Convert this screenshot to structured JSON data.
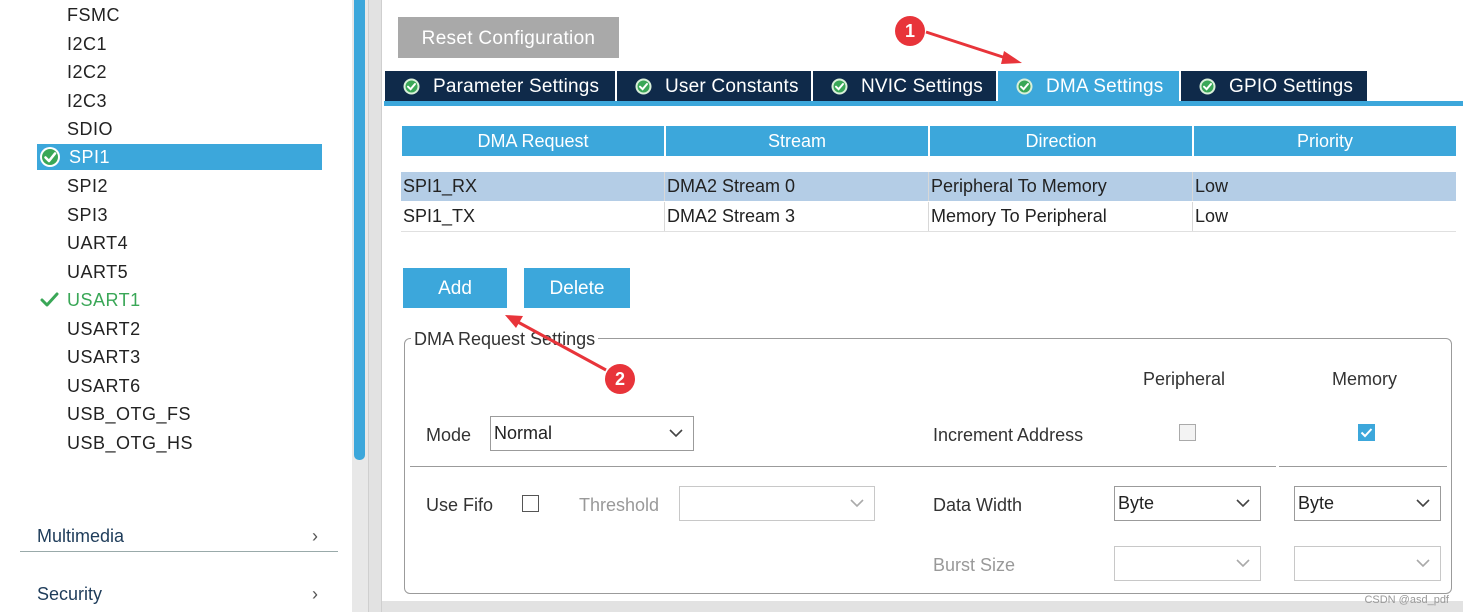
{
  "sidebar": {
    "items": [
      {
        "label": "FSMC",
        "state": "normal"
      },
      {
        "label": "I2C1",
        "state": "normal"
      },
      {
        "label": "I2C2",
        "state": "normal"
      },
      {
        "label": "I2C3",
        "state": "normal"
      },
      {
        "label": "SDIO",
        "state": "normal"
      },
      {
        "label": "SPI1",
        "state": "selected"
      },
      {
        "label": "SPI2",
        "state": "normal"
      },
      {
        "label": "SPI3",
        "state": "normal"
      },
      {
        "label": "UART4",
        "state": "normal"
      },
      {
        "label": "UART5",
        "state": "normal"
      },
      {
        "label": "USART1",
        "state": "enabled"
      },
      {
        "label": "USART2",
        "state": "normal"
      },
      {
        "label": "USART3",
        "state": "normal"
      },
      {
        "label": "USART6",
        "state": "normal"
      },
      {
        "label": "USB_OTG_FS",
        "state": "normal"
      },
      {
        "label": "USB_OTG_HS",
        "state": "normal"
      }
    ],
    "categories": [
      {
        "label": "Multimedia",
        "icon": "chevron-right-icon"
      },
      {
        "label": "Security",
        "icon": "chevron-right-icon"
      }
    ]
  },
  "toolbar": {
    "reset_label": "Reset Configuration"
  },
  "tabs": [
    {
      "label": "Parameter Settings",
      "icon": "check-circle-icon",
      "active": false
    },
    {
      "label": "User Constants",
      "icon": "check-circle-icon",
      "active": false
    },
    {
      "label": "NVIC Settings",
      "icon": "check-circle-icon",
      "active": false
    },
    {
      "label": "DMA Settings",
      "icon": "check-circle-icon",
      "active": true
    },
    {
      "label": "GPIO Settings",
      "icon": "check-circle-icon",
      "active": false
    }
  ],
  "dma_table": {
    "headers": [
      "DMA Request",
      "Stream",
      "Direction",
      "Priority"
    ],
    "rows": [
      {
        "request": "SPI1_RX",
        "stream": "DMA2 Stream 0",
        "direction": "Peripheral To Memory",
        "priority": "Low",
        "selected": true
      },
      {
        "request": "SPI1_TX",
        "stream": "DMA2 Stream 3",
        "direction": "Memory To Peripheral",
        "priority": "Low",
        "selected": false
      }
    ]
  },
  "actions": {
    "add_label": "Add",
    "delete_label": "Delete"
  },
  "request_settings": {
    "title": "DMA Request Settings",
    "col_peripheral": "Peripheral",
    "col_memory": "Memory",
    "mode_label": "Mode",
    "mode_value": "Normal",
    "increment_label": "Increment Address",
    "increment_peripheral_checked": false,
    "increment_memory_checked": true,
    "fifo_label": "Use Fifo",
    "fifo_checked": false,
    "threshold_label": "Threshold",
    "threshold_value": "",
    "data_width_label": "Data Width",
    "data_width_peripheral": "Byte",
    "data_width_memory": "Byte",
    "burst_label": "Burst Size",
    "burst_peripheral": "",
    "burst_memory": ""
  },
  "annotations": {
    "badge1": "1",
    "badge2": "2",
    "accent": "#e8343a"
  },
  "watermark": "CSDN @asd_pdf",
  "colors": {
    "accent": "#3ca7db",
    "tab_dark": "#0f2a4a",
    "enabled_green": "#3aa757"
  }
}
